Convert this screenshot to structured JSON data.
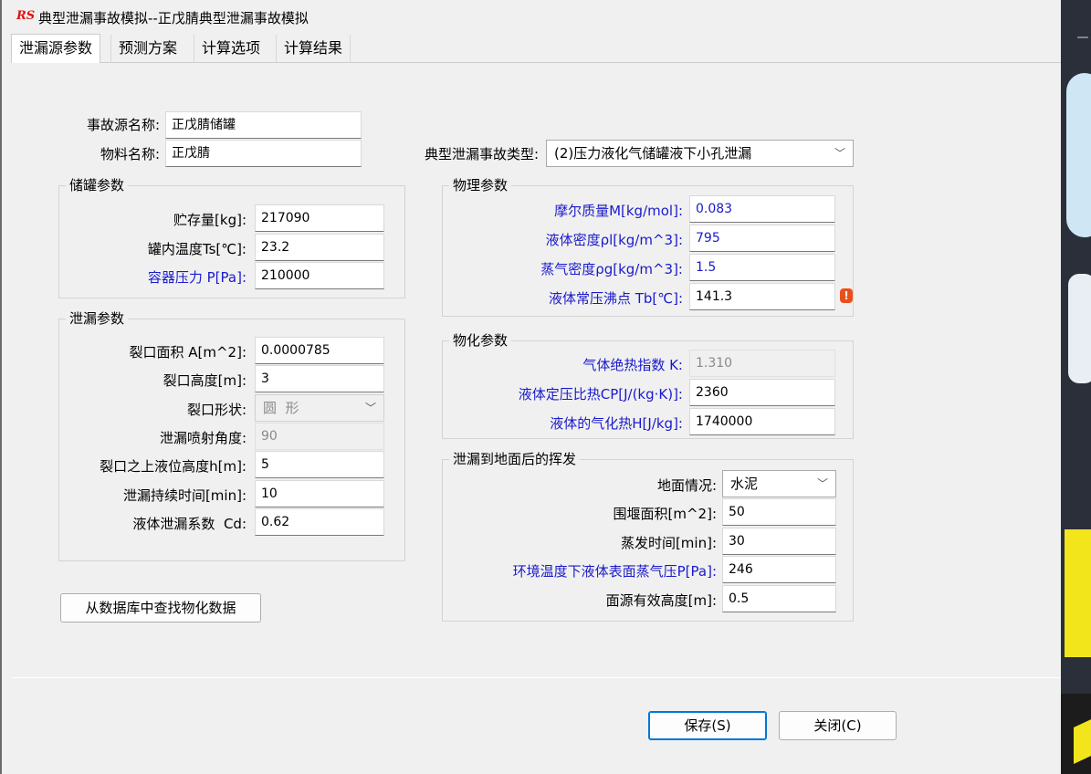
{
  "window": {
    "logo_text": "RS",
    "title": "典型泄漏事故模拟--正戊腈典型泄漏事故模拟"
  },
  "tabs": [
    "泄漏源参数",
    "预测方案",
    "计算选项",
    "计算结果"
  ],
  "source": {
    "name_label": "事故源名称:",
    "name_value": "正戊腈储罐",
    "material_label": "物料名称:",
    "material_value": "正戊腈",
    "type_label": "典型泄漏事故类型:",
    "type_value": "(2)压力液化气储罐液下小孔泄漏"
  },
  "tank_params": {
    "title": "储罐参数",
    "storage_label": "贮存量[kg]:",
    "storage_value": "217090",
    "temp_label": "罐内温度Ts[℃]:",
    "temp_value": "23.2",
    "pressure_label": "容器压力 P[Pa]:",
    "pressure_value": "210000"
  },
  "leak_params": {
    "title": "泄漏参数",
    "area_label": "裂口面积 A[m^2]:",
    "area_value": "0.0000785",
    "height_label": "裂口高度[m]:",
    "height_value": "3",
    "shape_label": "裂口形状:",
    "shape_value": "圆  形",
    "angle_label": "泄漏喷射角度:",
    "angle_value": "90",
    "liquid_height_label": "裂口之上液位高度h[m]:",
    "liquid_height_value": "5",
    "duration_label": "泄漏持续时间[min]:",
    "duration_value": "10",
    "cd_label": "液体泄漏系数  Cd:",
    "cd_value": "0.62"
  },
  "physical_params": {
    "title": "物理参数",
    "molar_label": "摩尔质量M[kg/mol]:",
    "molar_value": "0.083",
    "liquid_density_label": "液体密度ρl[kg/m^3]:",
    "liquid_density_value": "795",
    "vapor_density_label": "蒸气密度ρg[kg/m^3]:",
    "vapor_density_value": "1.5",
    "boiling_label": "液体常压沸点 Tb[℃]:",
    "boiling_value": "141.3",
    "warning_glyph": "!"
  },
  "chem_params": {
    "title": "物化参数",
    "k_label": "气体绝热指数 K:",
    "k_value": "1.310",
    "cp_label": "液体定压比热CP[J/(kg·K)]:",
    "cp_value": "2360",
    "h_label": "液体的气化热H[J/kg]:",
    "h_value": "1740000"
  },
  "ground": {
    "title": "泄漏到地面后的挥发",
    "surface_label": "地面情况:",
    "surface_value": "水泥",
    "dike_label": "围堰面积[m^2]:",
    "dike_value": "50",
    "evap_label": "蒸发时间[min]:",
    "evap_value": "30",
    "vapor_pressure_label": "环境温度下液体表面蒸气压P[Pa]:",
    "vapor_pressure_value": "246",
    "source_height_label": "面源有效高度[m]:",
    "source_height_value": "0.5"
  },
  "buttons": {
    "lookup": "从数据库中查找物化数据",
    "save": "保存(S)",
    "close": "关闭(C)"
  },
  "colors": {
    "accent_blue": "#1a1acc",
    "warning": "#e8501b",
    "focus": "#0078d7"
  }
}
